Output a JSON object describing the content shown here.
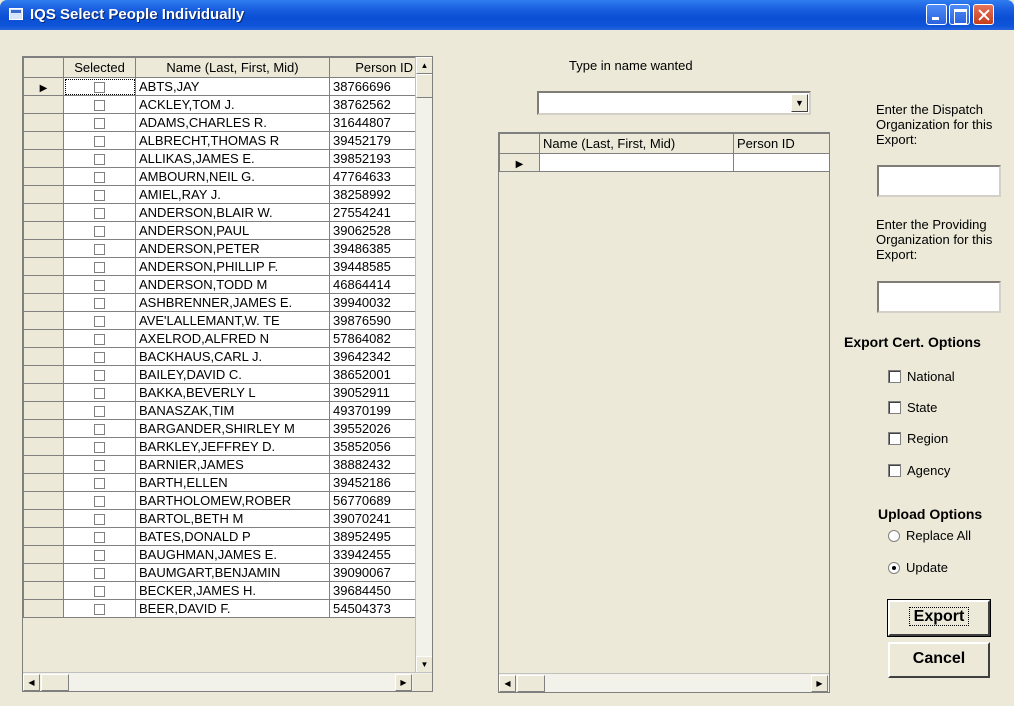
{
  "window": {
    "title": "IQS  Select People Individually"
  },
  "left_grid": {
    "columns": [
      "Selected",
      "Name (Last, First, Mid)",
      "Person ID"
    ],
    "rows": [
      {
        "name": "ABTS,JAY",
        "id": "38766696"
      },
      {
        "name": "ACKLEY,TOM J.",
        "id": "38762562"
      },
      {
        "name": "ADAMS,CHARLES R.",
        "id": "31644807"
      },
      {
        "name": "ALBRECHT,THOMAS R",
        "id": "39452179"
      },
      {
        "name": "ALLIKAS,JAMES E.",
        "id": "39852193"
      },
      {
        "name": "AMBOURN,NEIL G.",
        "id": "47764633"
      },
      {
        "name": "AMIEL,RAY J.",
        "id": "38258992"
      },
      {
        "name": "ANDERSON,BLAIR W.",
        "id": "27554241"
      },
      {
        "name": "ANDERSON,PAUL",
        "id": "39062528"
      },
      {
        "name": "ANDERSON,PETER",
        "id": "39486385"
      },
      {
        "name": "ANDERSON,PHILLIP F.",
        "id": "39448585"
      },
      {
        "name": "ANDERSON,TODD M",
        "id": "46864414"
      },
      {
        "name": "ASHBRENNER,JAMES E.",
        "id": "39940032"
      },
      {
        "name": "AVE'LALLEMANT,W. TE",
        "id": "39876590"
      },
      {
        "name": "AXELROD,ALFRED N",
        "id": "57864082"
      },
      {
        "name": "BACKHAUS,CARL J.",
        "id": "39642342"
      },
      {
        "name": "BAILEY,DAVID C.",
        "id": "38652001"
      },
      {
        "name": "BAKKA,BEVERLY L",
        "id": "39052911"
      },
      {
        "name": "BANASZAK,TIM",
        "id": "49370199"
      },
      {
        "name": "BARGANDER,SHIRLEY M",
        "id": "39552026"
      },
      {
        "name": "BARKLEY,JEFFREY D.",
        "id": "35852056"
      },
      {
        "name": "BARNIER,JAMES",
        "id": "38882432"
      },
      {
        "name": "BARTH,ELLEN",
        "id": "39452186"
      },
      {
        "name": "BARTHOLOMEW,ROBER",
        "id": "56770689"
      },
      {
        "name": "BARTOL,BETH M",
        "id": "39070241"
      },
      {
        "name": "BATES,DONALD P",
        "id": "38952495"
      },
      {
        "name": "BAUGHMAN,JAMES E.",
        "id": "33942455"
      },
      {
        "name": "BAUMGART,BENJAMIN",
        "id": "39090067"
      },
      {
        "name": "BECKER,JAMES H.",
        "id": "39684450"
      },
      {
        "name": "BEER,DAVID F.",
        "id": "54504373"
      }
    ]
  },
  "search": {
    "label": "Type in name wanted",
    "value": ""
  },
  "mid_grid": {
    "columns": [
      "Name (Last, First, Mid)",
      "Person ID"
    ]
  },
  "right_panel": {
    "dispatch_label": "Enter the Dispatch Organization for this Export:",
    "dispatch_value": "",
    "providing_label": "Enter the Providing Organization for this Export:",
    "providing_value": "",
    "export_cert_title": "Export Cert. Options",
    "cert_options": [
      "National",
      "State",
      "Region",
      "Agency"
    ],
    "upload_title": "Upload Options",
    "upload_options": [
      "Replace All",
      "Update"
    ],
    "upload_selected": "Update",
    "export_button": "Export",
    "cancel_button": "Cancel"
  }
}
